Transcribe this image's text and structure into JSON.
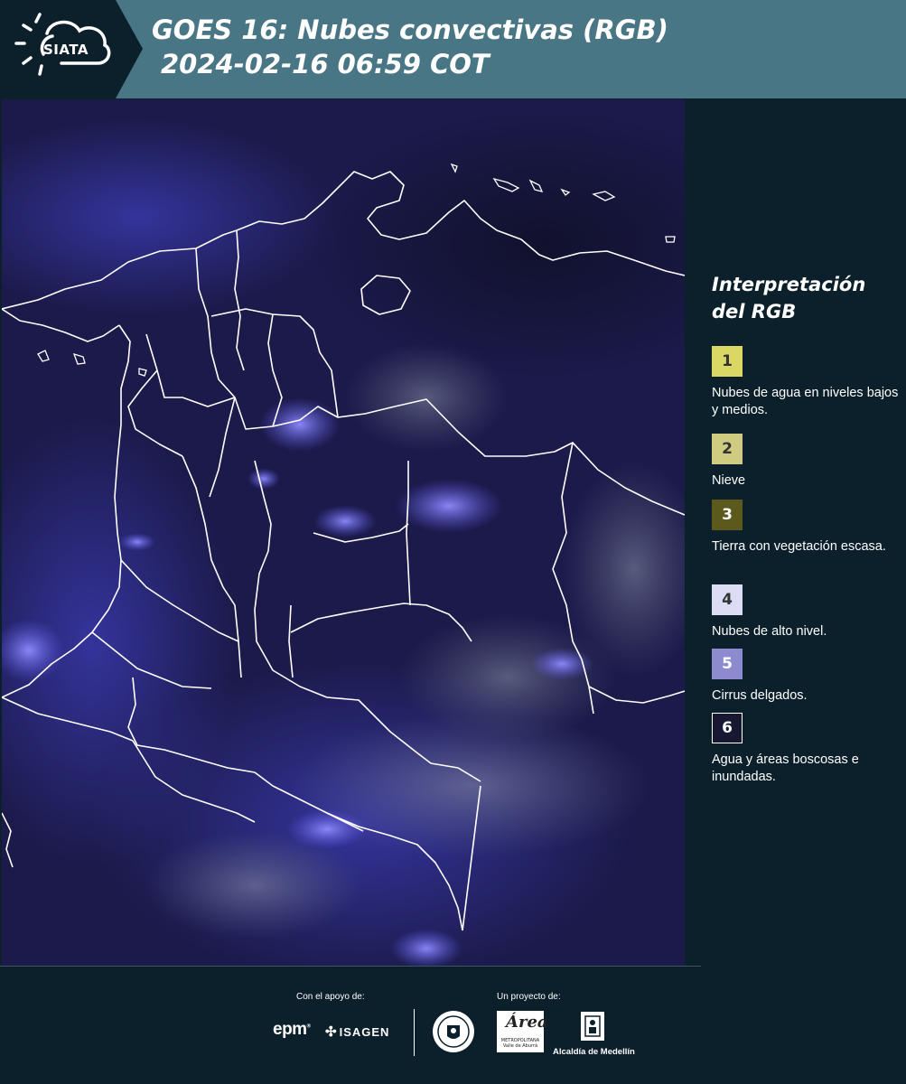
{
  "header": {
    "logo_text": "SIATA",
    "title_line1": "GOES 16: Nubes convectivas (RGB)",
    "title_line2": "2024-02-16 06:59 COT",
    "bar_color": "#497684"
  },
  "map": {
    "background_color": "#1a1947",
    "icon": "satellite-rgb-map"
  },
  "legend": {
    "title_line1": "Interpretación",
    "title_line2": "del RGB",
    "items": [
      {
        "number": "1",
        "label": "Nubes de agua en niveles bajos y medios.",
        "color": "#dbd765"
      },
      {
        "number": "2",
        "label": "Nieve",
        "color": "#cfcb80"
      },
      {
        "number": "3",
        "label": "Tierra con vegetación escasa.",
        "color": "#5c591c"
      },
      {
        "number": "4",
        "label": "Nubes de alto nivel.",
        "color": "#dcdcf5"
      },
      {
        "number": "5",
        "label": "Cirrus delgados.",
        "color": "#8d8bd0"
      },
      {
        "number": "6",
        "label": "Agua y áreas boscosas e inundadas.",
        "color": "#181833"
      }
    ]
  },
  "footer": {
    "support_label": "Con el apoyo de:",
    "project_label": "Un proyecto de:",
    "epm_text": "epm",
    "isagen_text": "ISAGEN",
    "area_text": "Área",
    "area_sub": "METROPOLITANA Valle de Aburrá",
    "alcaldia_text": "Alcaldía de Medellín"
  }
}
